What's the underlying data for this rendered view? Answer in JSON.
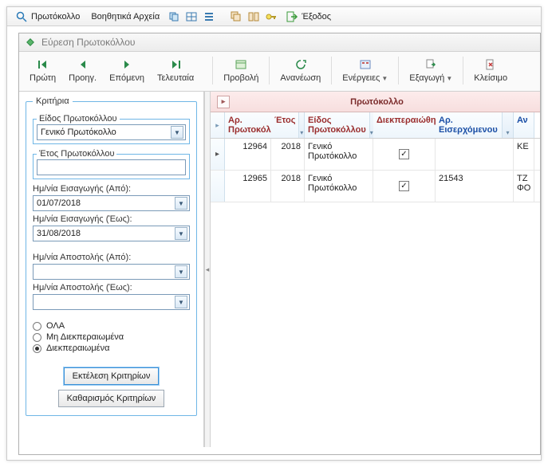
{
  "menubar": {
    "app_menu": "Πρωτόκολλο",
    "aux_menu": "Βοηθητικά Αρχεία",
    "exit": "Έξοδος"
  },
  "subwindow": {
    "title": "Εύρεση Πρωτοκόλλου"
  },
  "toolbar": {
    "first": "Πρώτη",
    "prev": "Προηγ.",
    "next": "Επόμενη",
    "last": "Τελευταία",
    "view": "Προβολή",
    "refresh": "Ανανέωση",
    "actions": "Ενέργειες",
    "export": "Εξαγωγή",
    "close": "Κλείσιμο"
  },
  "criteria": {
    "legend": "Κριτήρια",
    "type_legend": "Είδος Πρωτοκόλλου",
    "type_value": "Γενικό Πρωτόκολλο",
    "year_legend": "Έτος Πρωτοκόλλου",
    "year_value": "",
    "insert_from_label": "Ημ/νία Εισαγωγής (Από):",
    "insert_from_value": "01/07/2018",
    "insert_to_label": "Ημ/νία Εισαγωγής (Έως):",
    "insert_to_value": "31/08/2018",
    "send_from_label": "Ημ/νία Αποστολής (Από):",
    "send_from_value": "",
    "send_to_label": "Ημ/νία Αποστολής (Έως):",
    "send_to_value": "",
    "radio_all": "ΟΛΑ",
    "radio_pending": "Μη Διεκπεραιωμένα",
    "radio_done": "Διεκπεραιωμένα",
    "run": "Εκτέλεση Κριτηρίων",
    "clear": "Καθαρισμός Κριτηρίων"
  },
  "grid": {
    "band": "Πρωτόκολλο",
    "cols": {
      "ar": "Αρ. Πρωτοκόλλου",
      "etos": "Έτος",
      "eidos": "Είδος Πρωτοκόλλου",
      "diek": "Διεκπεραιώθηκε",
      "eis": "Αρ. Εισερχόμενου",
      "an": "Αν"
    },
    "rows": [
      {
        "ar": "12964",
        "etos": "2018",
        "eidos": "Γενικό Πρωτόκολλο",
        "diek": true,
        "eis": "",
        "an": "ΚΕ"
      },
      {
        "ar": "12965",
        "etos": "2018",
        "eidos": "Γενικό Πρωτόκολλο",
        "diek": true,
        "eis": "21543",
        "an": "ΤΖ ΦΟ"
      }
    ]
  }
}
